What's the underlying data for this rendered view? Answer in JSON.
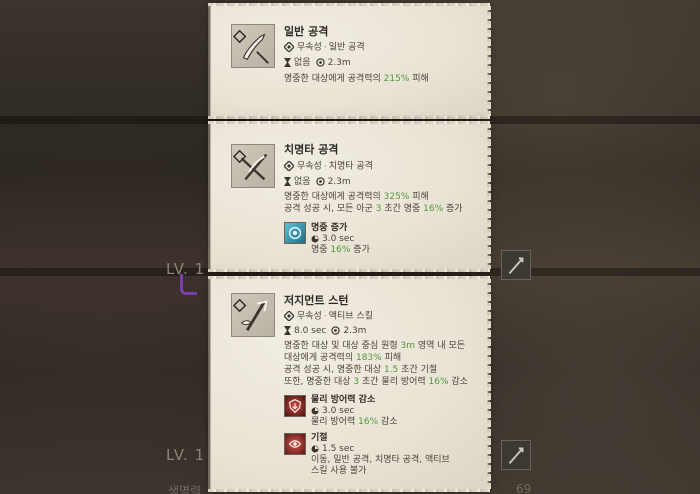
{
  "background": {
    "level_label_1": "LV. 1",
    "level_label_2": "LV. 1",
    "bottom_left_text": "생명력",
    "bottom_right_number": "69"
  },
  "cards": [
    {
      "title": "일반 공격",
      "attribute": "무속성",
      "type": "일반 공격",
      "cooldown": "없음",
      "range": "2.3m",
      "description_lines": [
        {
          "pre": "명중한 대상에게 공격력의 ",
          "value": "215%",
          "post": " 피해"
        }
      ]
    },
    {
      "title": "치명타 공격",
      "attribute": "무속성",
      "type": "치명타 공격",
      "cooldown": "없음",
      "range": "2.3m",
      "description_lines": [
        {
          "pre": "명중한 대상에게 공격력의 ",
          "value": "325%",
          "post": " 피해"
        },
        {
          "pre": "공격 성공 시, 모든 아군 ",
          "value": "3",
          "post": " 초간 명중 ",
          "value2": "16%",
          "post2": " 증가"
        }
      ],
      "buffs": [
        {
          "name": "명중 증가",
          "duration": "3.0 sec",
          "effect_pre": "명중 ",
          "effect_value": "16%",
          "effect_post": " 증가",
          "icon": "accuracy-up-icon"
        }
      ]
    },
    {
      "title": "저지먼트 스턴",
      "attribute": "무속성",
      "type": "액티브 스킬",
      "cooldown": "8.0 sec",
      "range": "2.3m",
      "description_lines": [
        {
          "pre": "명중한 대상 및 대상 중심 원형 ",
          "value": "3m",
          "post": " 영역 내 모든"
        },
        {
          "pre": "대상에게 공격력의 ",
          "value": "183%",
          "post": " 피해"
        },
        {
          "pre": "공격 성공 시, 명중한 대상 ",
          "value": "1.5",
          "post": " 초간 기절"
        },
        {
          "pre": "또한, 명중한 대상 ",
          "value": "3",
          "post": " 초간 물리 방어력 ",
          "value2": "16%",
          "post2": " 감소"
        }
      ],
      "buffs": [
        {
          "name": "물리 방어력 감소",
          "duration": "3.0 sec",
          "effect_pre": "물리 방어력 ",
          "effect_value": "16%",
          "effect_post": " 감소",
          "icon": "defense-down-icon"
        },
        {
          "name": "기절",
          "duration": "1.5 sec",
          "effect_line1": "이동, 일반 공격, 치명타 공격, 액티브",
          "effect_line2": "스킬 사용 불가",
          "icon": "stun-icon"
        }
      ]
    }
  ],
  "colors": {
    "highlight_green": "#4f9a3c",
    "parchment": "#ebe5d8",
    "debuff_red": "#8e2a2a",
    "buff_teal": "#2c8aa5"
  }
}
